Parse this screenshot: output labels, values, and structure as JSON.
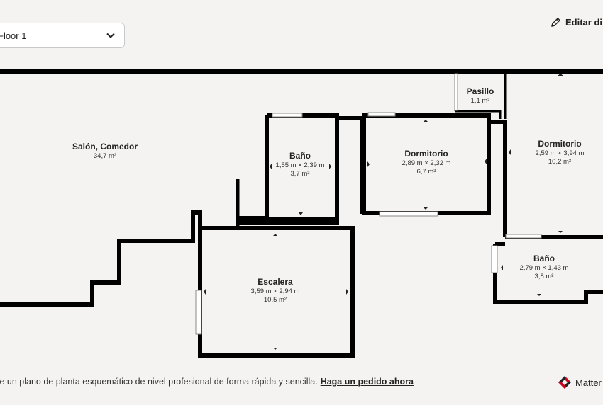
{
  "toolbar": {
    "floor_select_value": "Floor 1",
    "edit_label": "Editar di"
  },
  "rooms": [
    {
      "name": "Salón, Comedor",
      "dims": "",
      "area": "34,7 m²"
    },
    {
      "name": "Pasillo",
      "dims": "",
      "area": "1,1 m²"
    },
    {
      "name": "Baño",
      "dims": "1,55 m × 2,39 m",
      "area": "3,7 m²"
    },
    {
      "name": "Dormitorio",
      "dims": "2,89 m × 2,32 m",
      "area": "6,7 m²"
    },
    {
      "name": "Dormitorio",
      "dims": "2,59 m × 3,94 m",
      "area": "10,2 m²"
    },
    {
      "name": "Escalera",
      "dims": "3,59 m × 2,94 m",
      "area": "10,5 m²"
    },
    {
      "name": "Baño",
      "dims": "2,79 m × 1,43 m",
      "area": "3,8 m²"
    }
  ],
  "footer": {
    "message": "te un plano de planta esquemático de nivel profesional de forma rápida y sencilla.",
    "cta": "Haga un pedido ahora",
    "brand": "Matter"
  },
  "colors": {
    "wall": "#000000",
    "background": "#f4f3f2",
    "brand_red": "#d0021b"
  }
}
